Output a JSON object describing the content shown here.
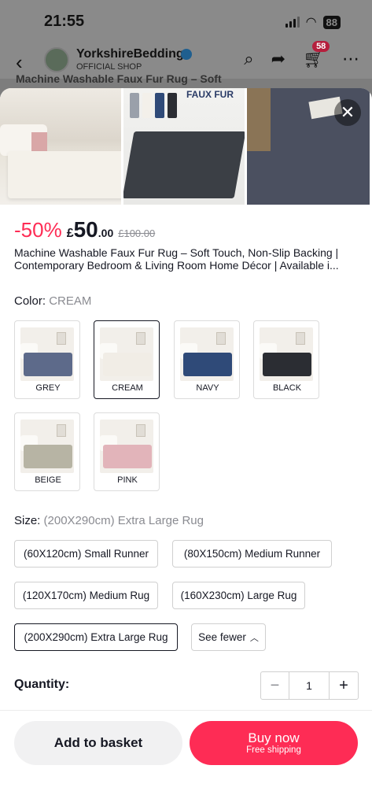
{
  "status": {
    "time": "21:55",
    "battery": "88"
  },
  "header": {
    "shop_name": "YorkshireBedding",
    "shop_sub": "OFFICIAL SHOP",
    "cart_count": "58",
    "behind_title": "Machine Washable Faux Fur Rug – Soft"
  },
  "gallery": {
    "image2_title": "FAUX FUR"
  },
  "price": {
    "discount": "-50%",
    "currency": "£",
    "integer": "50",
    "decimal": ".00",
    "original": "£100.00"
  },
  "product_title": "Machine Washable Faux Fur Rug – Soft Touch, Non-Slip Backing | Contemporary Bedroom & Living Room Home Décor | Available i...",
  "color": {
    "label": "Color:",
    "selected": "CREAM",
    "options": [
      {
        "name": "GREY",
        "swatch": "#5d6a8a"
      },
      {
        "name": "CREAM",
        "swatch": "#f1ede6"
      },
      {
        "name": "NAVY",
        "swatch": "#2f4a78"
      },
      {
        "name": "BLACK",
        "swatch": "#2b2d33"
      },
      {
        "name": "BEIGE",
        "swatch": "#b7b4a4"
      },
      {
        "name": "PINK",
        "swatch": "#e2b4ba"
      }
    ]
  },
  "size": {
    "label": "Size:",
    "selected": "(200X290cm) Extra Large Rug",
    "options": [
      "(60X120cm) Small Runner",
      "(80X150cm)  Medium Runner",
      "(120X170cm) Medium Rug",
      "(160X230cm) Large Rug",
      "(200X290cm) Extra Large Rug"
    ],
    "see_fewer": "See fewer"
  },
  "quantity": {
    "label": "Quantity:",
    "value": "1",
    "minus": "−",
    "plus": "+"
  },
  "actions": {
    "add_to_basket": "Add to basket",
    "buy_now": "Buy now",
    "buy_sub": "Free shipping"
  },
  "colors": {
    "accent": "#fe2c55",
    "text": "#161823",
    "muted": "#8a8b91"
  }
}
